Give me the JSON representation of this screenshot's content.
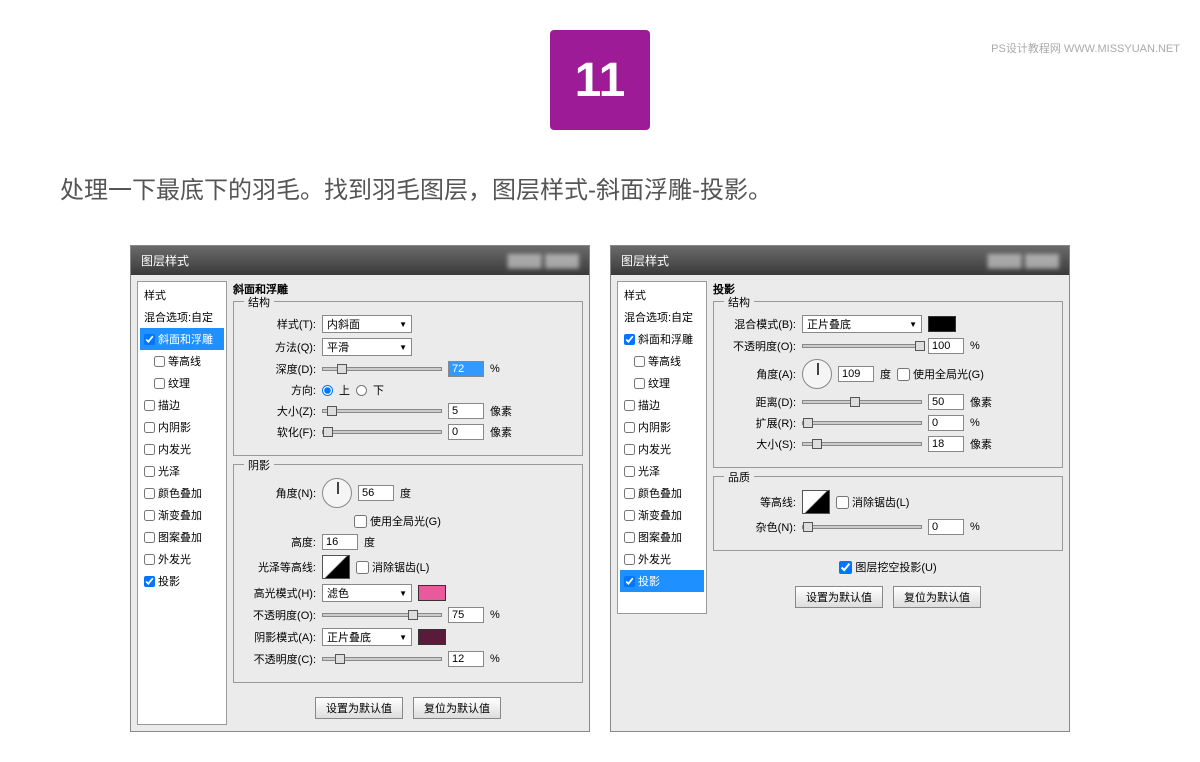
{
  "watermark": "PS设计教程网  WWW.MISSYUAN.NET",
  "step": "11",
  "instruction": "处理一下最底下的羽毛。找到羽毛图层，图层样式-斜面浮雕-投影。",
  "dialog1": {
    "title": "图层样式",
    "sidebar": {
      "header": "样式",
      "blend": "混合选项:自定",
      "items": [
        {
          "label": "斜面和浮雕",
          "checked": true,
          "selected": true
        },
        {
          "label": "等高线",
          "checked": false,
          "indent": true
        },
        {
          "label": "纹理",
          "checked": false,
          "indent": true
        },
        {
          "label": "描边",
          "checked": false
        },
        {
          "label": "内阴影",
          "checked": false
        },
        {
          "label": "内发光",
          "checked": false
        },
        {
          "label": "光泽",
          "checked": false
        },
        {
          "label": "颜色叠加",
          "checked": false
        },
        {
          "label": "渐变叠加",
          "checked": false
        },
        {
          "label": "图案叠加",
          "checked": false
        },
        {
          "label": "外发光",
          "checked": false
        },
        {
          "label": "投影",
          "checked": true
        }
      ]
    },
    "section_title": "斜面和浮雕",
    "structure": {
      "title": "结构",
      "style_lbl": "样式(T):",
      "style_val": "内斜面",
      "method_lbl": "方法(Q):",
      "method_val": "平滑",
      "depth_lbl": "深度(D):",
      "depth_val": "72",
      "depth_unit": "%",
      "direction_lbl": "方向:",
      "dir_up": "上",
      "dir_down": "下",
      "size_lbl": "大小(Z):",
      "size_val": "5",
      "size_unit": "像素",
      "soften_lbl": "软化(F):",
      "soften_val": "0",
      "soften_unit": "像素"
    },
    "shading": {
      "title": "阴影",
      "angle_lbl": "角度(N):",
      "angle_val": "56",
      "angle_unit": "度",
      "global_light": "使用全局光(G)",
      "altitude_lbl": "高度:",
      "altitude_val": "16",
      "altitude_unit": "度",
      "contour_lbl": "光泽等高线:",
      "anti_alias": "消除锯齿(L)",
      "highlight_mode_lbl": "高光模式(H):",
      "highlight_mode_val": "滤色",
      "highlight_op_lbl": "不透明度(O):",
      "highlight_op_val": "75",
      "op_unit": "%",
      "shadow_mode_lbl": "阴影模式(A):",
      "shadow_mode_val": "正片叠底",
      "shadow_op_lbl": "不透明度(C):",
      "shadow_op_val": "12"
    },
    "btns": {
      "default": "设置为默认值",
      "reset": "复位为默认值"
    }
  },
  "dialog2": {
    "title": "图层样式",
    "sidebar": {
      "header": "样式",
      "blend": "混合选项:自定",
      "items": [
        {
          "label": "斜面和浮雕",
          "checked": true
        },
        {
          "label": "等高线",
          "checked": false,
          "indent": true
        },
        {
          "label": "纹理",
          "checked": false,
          "indent": true
        },
        {
          "label": "描边",
          "checked": false
        },
        {
          "label": "内阴影",
          "checked": false
        },
        {
          "label": "内发光",
          "checked": false
        },
        {
          "label": "光泽",
          "checked": false
        },
        {
          "label": "颜色叠加",
          "checked": false
        },
        {
          "label": "渐变叠加",
          "checked": false
        },
        {
          "label": "图案叠加",
          "checked": false
        },
        {
          "label": "外发光",
          "checked": false
        },
        {
          "label": "投影",
          "checked": true,
          "selected": true
        }
      ]
    },
    "section_title": "投影",
    "structure": {
      "title": "结构",
      "blend_lbl": "混合模式(B):",
      "blend_val": "正片叠底",
      "opacity_lbl": "不透明度(O):",
      "opacity_val": "100",
      "op_unit": "%",
      "angle_lbl": "角度(A):",
      "angle_val": "109",
      "angle_unit": "度",
      "global_light": "使用全局光(G)",
      "distance_lbl": "距离(D):",
      "distance_val": "50",
      "distance_unit": "像素",
      "spread_lbl": "扩展(R):",
      "spread_val": "0",
      "spread_unit": "%",
      "size_lbl": "大小(S):",
      "size_val": "18",
      "size_unit": "像素"
    },
    "quality": {
      "title": "品质",
      "contour_lbl": "等高线:",
      "anti_alias": "消除锯齿(L)",
      "noise_lbl": "杂色(N):",
      "noise_val": "0",
      "noise_unit": "%"
    },
    "knockout": "图层挖空投影(U)",
    "btns": {
      "default": "设置为默认值",
      "reset": "复位为默认值"
    }
  }
}
